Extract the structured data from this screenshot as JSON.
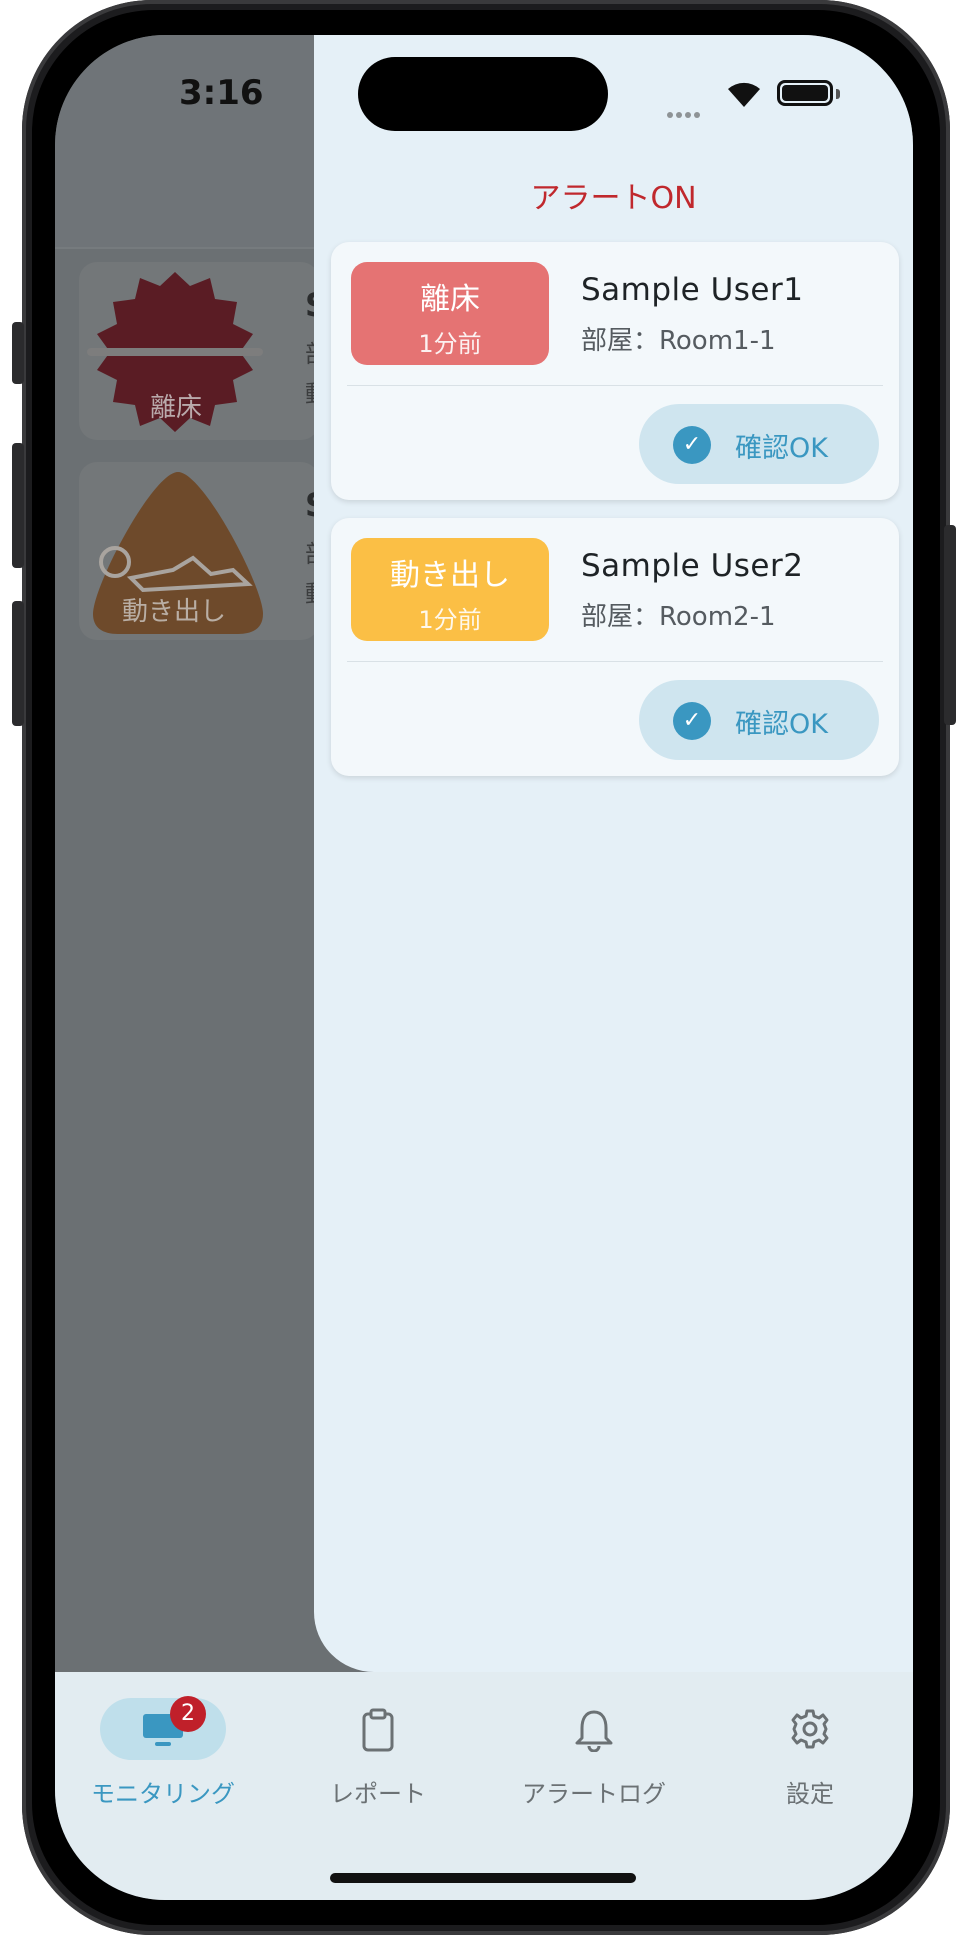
{
  "status_bar": {
    "time": "3:16"
  },
  "background_list": {
    "items": [
      {
        "icon": "bed-exit-alert-icon",
        "icon_label": "離床",
        "name_initial": "S",
        "line1": "部",
        "line2": "動"
      },
      {
        "icon": "movement-alert-icon",
        "icon_label": "動き出し",
        "name_initial": "S",
        "line1": "部",
        "line2": "動"
      }
    ]
  },
  "drawer": {
    "title": "アラートON",
    "alerts": [
      {
        "type_label": "離床",
        "elapsed": "1分前",
        "color": "#e57373",
        "user": "Sample User1",
        "room": "部屋：Room1-1",
        "confirm_label": "確認OK"
      },
      {
        "type_label": "動き出し",
        "elapsed": "1分前",
        "color": "#fbbf45",
        "user": "Sample User2",
        "room": "部屋：Room2-1",
        "confirm_label": "確認OK"
      }
    ]
  },
  "bottom_nav": {
    "items": [
      {
        "label": "モニタリング",
        "icon": "monitor-icon",
        "active": true,
        "badge": "2"
      },
      {
        "label": "レポート",
        "icon": "clipboard-icon",
        "active": false
      },
      {
        "label": "アラートログ",
        "icon": "bell-icon",
        "active": false
      },
      {
        "label": "設定",
        "icon": "gear-icon",
        "active": false
      }
    ]
  },
  "colors": {
    "accent": "#3a97c1",
    "alert_title": "#c0282d",
    "badge_red": "#c0202a"
  }
}
